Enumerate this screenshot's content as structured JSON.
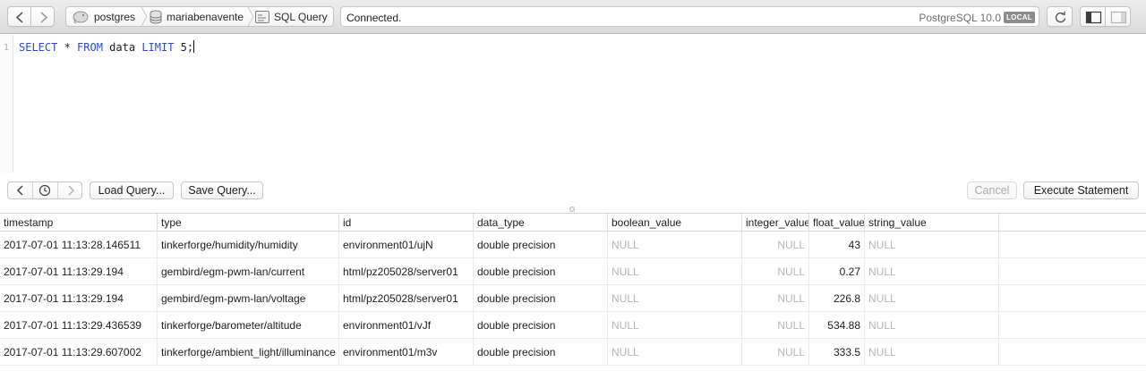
{
  "toolbar": {
    "back_icon": "chevron-left-icon",
    "forward_icon": "chevron-right-icon",
    "breadcrumb": {
      "server": "postgres",
      "database": "mariabenavente",
      "view": "SQL Query"
    },
    "status": "Connected.",
    "server_version": "PostgreSQL 10.0",
    "server_badge": "LOCAL"
  },
  "editor": {
    "line_numbers": [
      "1"
    ],
    "tokens": {
      "t1": "SELECT",
      "t2": " * ",
      "t3": "FROM",
      "t4": " data ",
      "t5": "LIMIT",
      "t6": " 5;"
    },
    "keyword_color": "#2e49c8"
  },
  "query_bar": {
    "load_label": "Load Query...",
    "save_label": "Save Query...",
    "cancel_label": "Cancel",
    "execute_label": "Execute Statement"
  },
  "results": {
    "columns": [
      "timestamp",
      "type",
      "id",
      "data_type",
      "boolean_value",
      "integer_value",
      "float_value",
      "string_value"
    ],
    "rows": [
      [
        "2017-07-01 11:13:28.146511",
        "tinkerforge/humidity/humidity",
        "environment01/ujN",
        "double precision",
        "NULL",
        "NULL",
        "43",
        "NULL"
      ],
      [
        "2017-07-01 11:13:29.194",
        "gembird/egm-pwm-lan/current",
        "html/pz205028/server01",
        "double precision",
        "NULL",
        "NULL",
        "0.27",
        "NULL"
      ],
      [
        "2017-07-01 11:13:29.194",
        "gembird/egm-pwm-lan/voltage",
        "html/pz205028/server01",
        "double precision",
        "NULL",
        "NULL",
        "226.8",
        "NULL"
      ],
      [
        "2017-07-01 11:13:29.436539",
        "tinkerforge/barometer/altitude",
        "environment01/vJf",
        "double precision",
        "NULL",
        "NULL",
        "534.88",
        "NULL"
      ],
      [
        "2017-07-01 11:13:29.607002",
        "tinkerforge/ambient_light/illuminance",
        "environment01/m3v",
        "double precision",
        "NULL",
        "NULL",
        "333.5",
        "NULL"
      ]
    ]
  }
}
